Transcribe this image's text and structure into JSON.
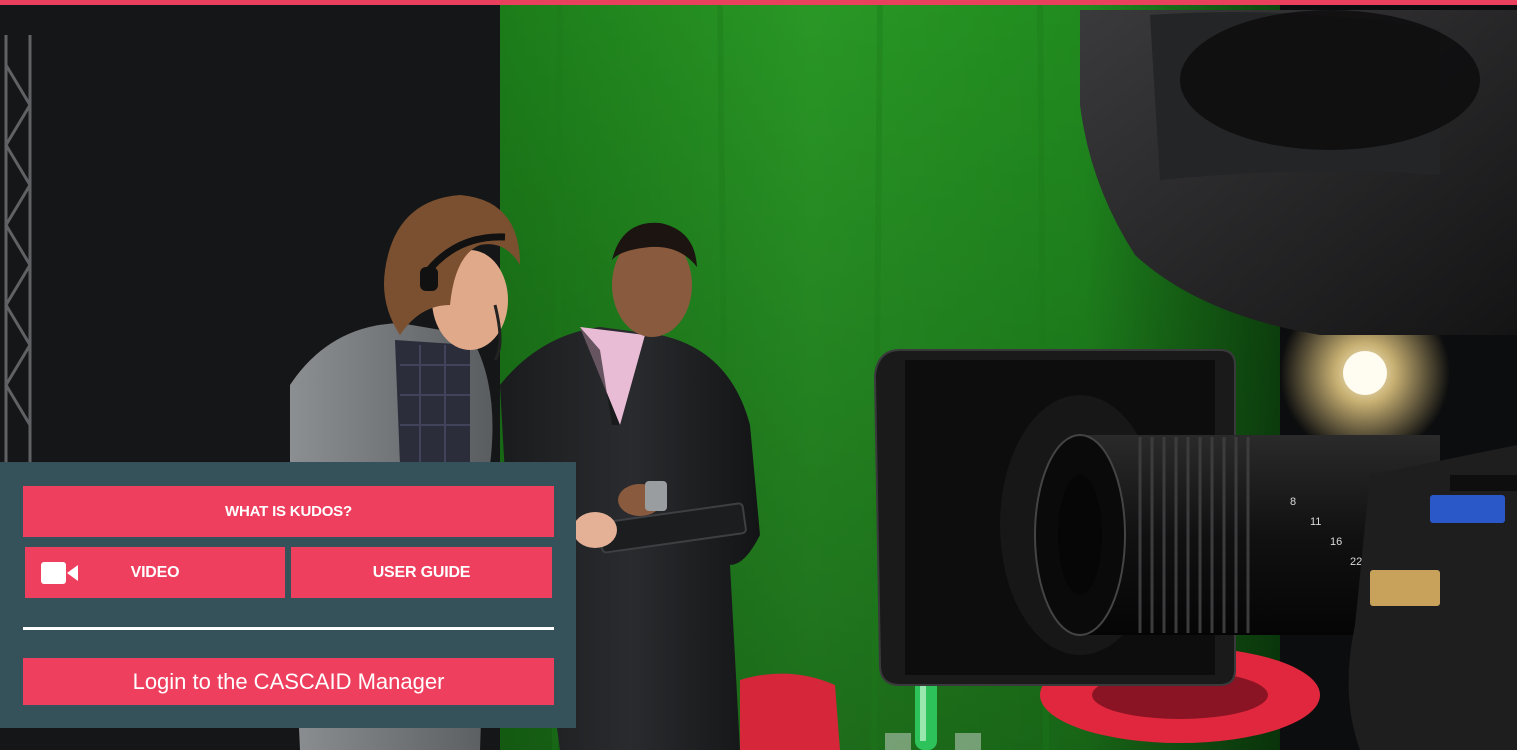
{
  "colors": {
    "accent": "#ef3f5e",
    "panel": "#35525b",
    "top_bar": "#e9405e",
    "divider": "#ffffff"
  },
  "hero": {
    "description_icon": "hero-photo-tv-studio"
  },
  "panel": {
    "what_is_label": "WHAT IS KUDOS?",
    "video_label": "VIDEO",
    "video_icon": "video-camera-icon",
    "user_guide_label": "USER GUIDE",
    "login_label": "Login to the CASCAID Manager"
  }
}
